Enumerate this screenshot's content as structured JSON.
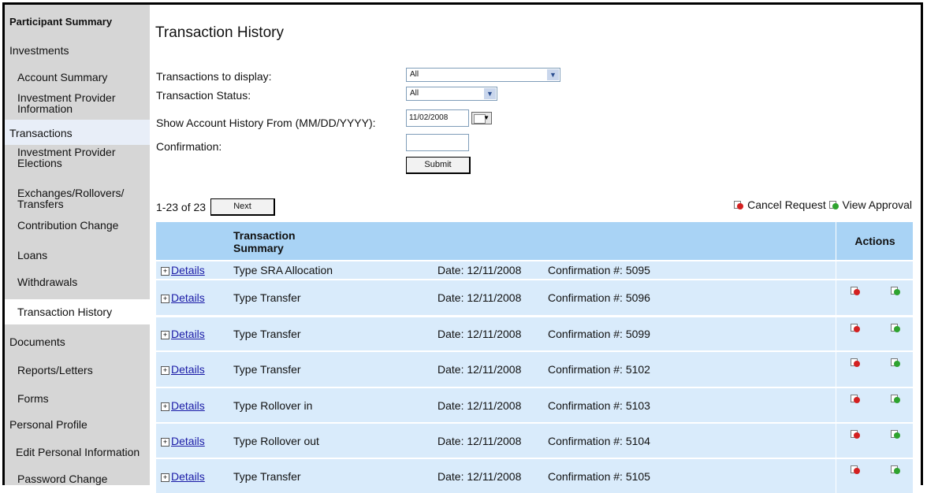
{
  "sidebar": {
    "items": [
      {
        "label": "Participant Summary"
      },
      {
        "label": "Investments"
      },
      {
        "label": "Account Summary"
      },
      {
        "label": "Investment Provider Information"
      },
      {
        "label": "Transactions"
      },
      {
        "label": "Investment Provider Elections"
      },
      {
        "label": "Exchanges/Rollovers/ Transfers"
      },
      {
        "label": "Contribution Change"
      },
      {
        "label": "Loans"
      },
      {
        "label": "Withdrawals"
      },
      {
        "label": "Transaction History"
      },
      {
        "label": "Documents"
      },
      {
        "label": "Reports/Letters"
      },
      {
        "label": "Forms"
      },
      {
        "label": "Personal Profile"
      },
      {
        "label": "Edit Personal Information"
      },
      {
        "label": "Password Change"
      }
    ]
  },
  "page": {
    "title": "Transaction History"
  },
  "filters": {
    "display_label": "Transactions to display:",
    "display_value": "All",
    "status_label": "Transaction Status:",
    "status_value": "All",
    "from_label": "Show Account History From (MM/DD/YYYY):",
    "from_value": "11/02/2008",
    "confirmation_label": "Confirmation:",
    "confirmation_value": "",
    "submit_label": "Submit"
  },
  "pager": {
    "range": "1-23 of 23",
    "next_label": "Next"
  },
  "legend": {
    "cancel_label": "Cancel Request",
    "approval_label": "View Approval"
  },
  "table": {
    "summary_header": "Transaction Summary",
    "actions_header": "Actions",
    "rows": [
      {
        "details": "Details",
        "type": "Type  SRA Allocation",
        "date": "Date: 12/11/2008",
        "confirmation": "Confirmation #: 5095",
        "actions": false
      },
      {
        "details": "Details",
        "type": "Type  Transfer",
        "date": "Date: 12/11/2008",
        "confirmation": "Confirmation #: 5096",
        "actions": true
      },
      {
        "details": "Details",
        "type": "Type  Transfer",
        "date": "Date: 12/11/2008",
        "confirmation": "Confirmation #: 5099",
        "actions": true
      },
      {
        "details": "Details",
        "type": "Type  Transfer",
        "date": "Date: 12/11/2008",
        "confirmation": "Confirmation #: 5102",
        "actions": true
      },
      {
        "details": "Details",
        "type": "Type  Rollover in",
        "date": "Date: 12/11/2008",
        "confirmation": "Confirmation #: 5103",
        "actions": true
      },
      {
        "details": "Details",
        "type": "Type  Rollover out",
        "date": "Date: 12/11/2008",
        "confirmation": "Confirmation #: 5104",
        "actions": true
      },
      {
        "details": "Details",
        "type": "Type  Transfer",
        "date": "Date: 12/11/2008",
        "confirmation": "Confirmation #: 5105",
        "actions": true
      }
    ]
  },
  "colors": {
    "header_bg": "#a9d3f5",
    "row_bg": "#d9ebfb",
    "sidebar_bg": "#d6d6d6",
    "link": "#1a1aa6"
  },
  "icons": {
    "cancel": "cancel-request-icon",
    "approval": "view-approval-icon",
    "expand": "expand-plus-icon",
    "calendar": "calendar-icon"
  }
}
